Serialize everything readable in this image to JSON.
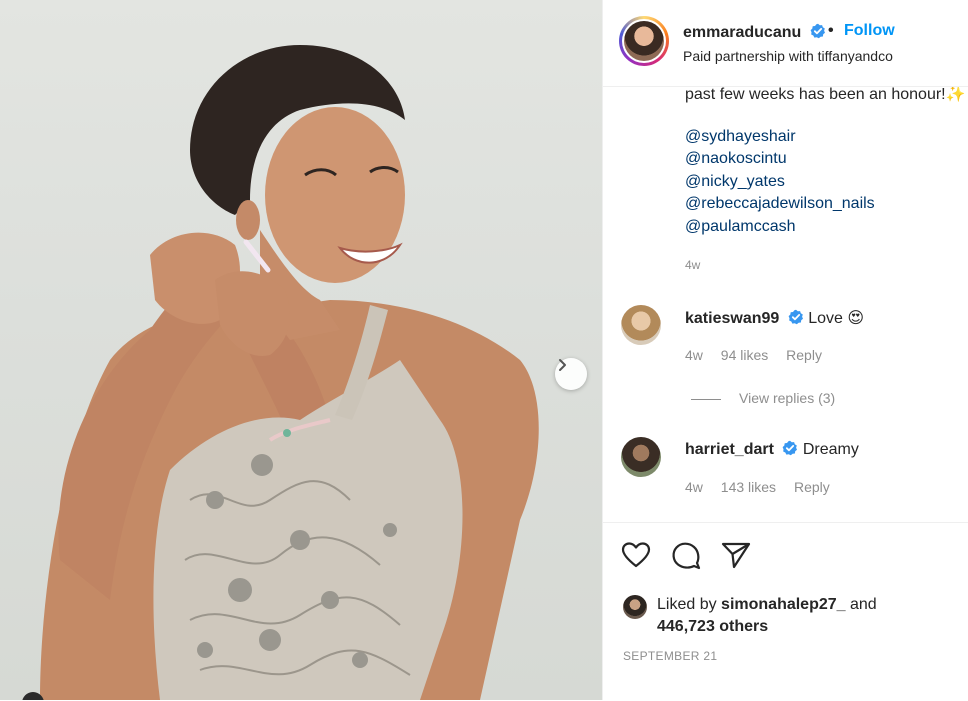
{
  "post": {
    "photo_alt": "Woman in embellished halter dress fastening an earring",
    "carousel_next_icon": "chevron-right-icon"
  },
  "header": {
    "username": "emmaraducanu",
    "verified_icon": "verified-badge-icon",
    "separator": "•",
    "follow_label": "Follow",
    "subtitle": "Paid partnership with tiffanyandco"
  },
  "caption": {
    "partial_line": "past few weeks has been an honour!",
    "mentions": [
      "@sydhayeshair",
      "@naokoscintu",
      "@nicky_yates",
      "@rebeccajadewilson_nails",
      "@paulamccash"
    ],
    "time": "4w"
  },
  "comments": [
    {
      "username": "katieswan99",
      "text": "Love 😍",
      "time": "4w",
      "likes": "94 likes",
      "reply": "Reply",
      "view_replies": "View replies (3)"
    },
    {
      "username": "harriet_dart",
      "text": "Dreamy",
      "time": "4w",
      "likes": "143 likes",
      "reply": "Reply"
    }
  ],
  "actions": {
    "icons": [
      "heart-icon",
      "comment-icon",
      "share-icon"
    ],
    "liked_prefix": "Liked by",
    "liked_user": "simonahalep27_",
    "liked_and": "and",
    "liked_others": "446,723 others",
    "date": "SEPTEMBER 21"
  },
  "colors": {
    "link_blue": "#0095f6",
    "mention_blue": "#00376b",
    "verified_blue": "#3897f0",
    "text": "#262626",
    "muted": "#8e8e8e"
  }
}
